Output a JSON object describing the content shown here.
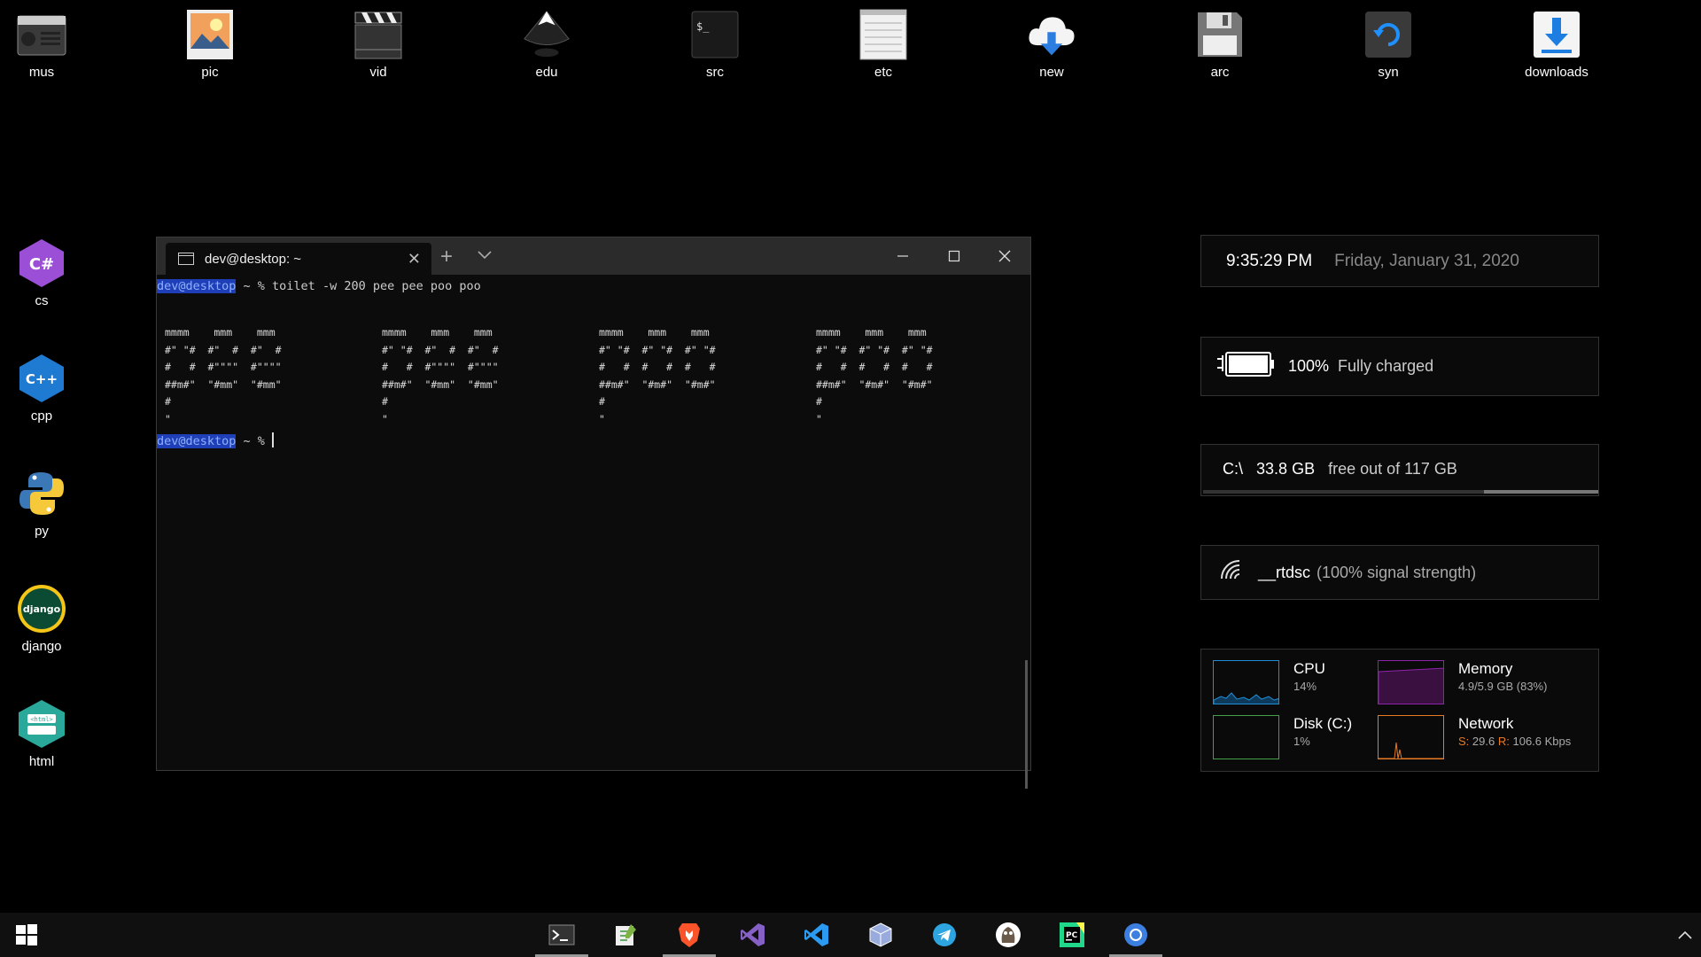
{
  "desktop": {
    "top_icons": [
      {
        "label": "mus",
        "icon": "radio-icon"
      },
      {
        "label": "pic",
        "icon": "picture-icon"
      },
      {
        "label": "vid",
        "icon": "clapperboard-icon"
      },
      {
        "label": "edu",
        "icon": "inkscape-icon"
      },
      {
        "label": "src",
        "icon": "terminal-icon"
      },
      {
        "label": "etc",
        "icon": "notepad-icon"
      },
      {
        "label": "new",
        "icon": "cloud-download-icon"
      },
      {
        "label": "arc",
        "icon": "floppy-disk-icon"
      },
      {
        "label": "syn",
        "icon": "sync-icon"
      },
      {
        "label": "downloads",
        "icon": "download-icon"
      }
    ],
    "left_icons": [
      {
        "label": "cs",
        "icon": "csharp-icon",
        "glyph": "C#"
      },
      {
        "label": "cpp",
        "icon": "cpp-icon",
        "glyph": "C++"
      },
      {
        "label": "py",
        "icon": "python-icon",
        "glyph": ""
      },
      {
        "label": "django",
        "icon": "django-icon",
        "glyph": "django"
      },
      {
        "label": "html",
        "icon": "html-css-icon",
        "glyph": "<html>"
      }
    ]
  },
  "terminal": {
    "tab_title": "dev@desktop: ~",
    "new_tab": "+",
    "prompt_user": "dev@desktop",
    "prompt_rest": " ~ % ",
    "command": "toilet -w 200 pee pee poo poo",
    "ascii_blocks": [
      "mmmm    mmm    mmm\n#\" \"#  #\"  #  #\"  #\n#   #  #\"\"\"\"  #\"\"\"\"\n##m#\"  \"#mm\"  \"#mm\"\n#\n\"",
      "mmmm    mmm    mmm\n#\" \"#  #\"  #  #\"  #\n#   #  #\"\"\"\"  #\"\"\"\"\n##m#\"  \"#mm\"  \"#mm\"\n#\n\"",
      "mmmm    mmm    mmm\n#\" \"#  #\" \"#  #\" \"#\n#   #  #   #  #   #\n##m#\"  \"#m#\"  \"#m#\"\n#\n\"",
      "mmmm    mmm    mmm\n#\" \"#  #\" \"#  #\" \"#\n#   #  #   #  #   #\n##m#\"  \"#m#\"  \"#m#\"\n#\n\""
    ]
  },
  "widgets": {
    "clock": {
      "time": "9:35:29 PM",
      "date": "Friday, January 31, 2020"
    },
    "battery": {
      "percent": "100%",
      "status": "Fully charged",
      "level": 1.0
    },
    "disk": {
      "drive": "C:\\",
      "free": "33.8 GB",
      "of_text": "free out of 117 GB",
      "used_fraction": 0.71
    },
    "wifi": {
      "ssid": "__rtdsc",
      "signal": "(100% signal strength)"
    },
    "perf": {
      "cpu": {
        "name": "CPU",
        "value": "14%",
        "color": "#1e8fd6"
      },
      "memory": {
        "name": "Memory",
        "value": "4.9/5.9 GB (83%)",
        "color": "#8e24aa"
      },
      "disk": {
        "name": "Disk (C:)",
        "value": "1%",
        "color": "#43a047"
      },
      "network": {
        "name": "Network",
        "s_label": "S:",
        "s_value": "29.6",
        "r_label": "R:",
        "r_value": "106.6 Kbps",
        "color": "#e87a24"
      }
    }
  },
  "taskbar": {
    "apps": [
      {
        "icon": "terminal-icon",
        "active": true
      },
      {
        "icon": "notepadpp-icon",
        "active": false
      },
      {
        "icon": "brave-icon",
        "active": true
      },
      {
        "icon": "visual-studio-icon",
        "active": false
      },
      {
        "icon": "vscode-icon",
        "active": false
      },
      {
        "icon": "virtualbox-icon",
        "active": false
      },
      {
        "icon": "telegram-icon",
        "active": false
      },
      {
        "icon": "gimp-icon",
        "active": false
      },
      {
        "icon": "pycharm-icon",
        "active": false
      },
      {
        "icon": "chrome-icon",
        "active": true
      }
    ]
  }
}
